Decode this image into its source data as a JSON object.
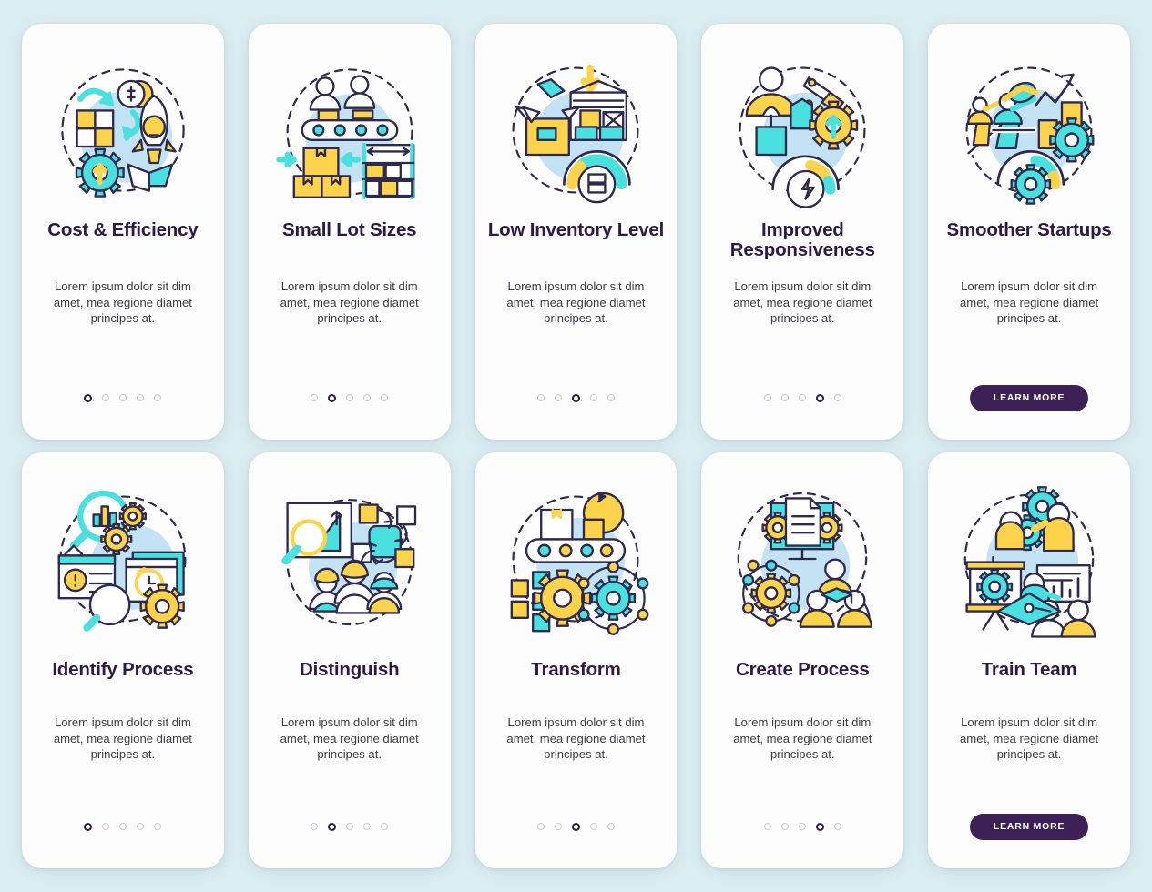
{
  "theme": {
    "background": "#dcedf1",
    "card_bg": "#fdfdfd",
    "title_color": "#2e1a47",
    "body_color": "#3a3a46",
    "accent_cyan": "#4ae0e0",
    "accent_yellow": "#fcd34a",
    "accent_lightblue": "#c3e3f5",
    "outline": "#2e2a4f",
    "button_bg": "#3d2156",
    "dot_inactive": "#c9c9d2"
  },
  "shared": {
    "description": "Lorem ipsum dolor sit dim amet, mea regione diamet principes at.",
    "learn_more_label": "LEARN MORE"
  },
  "rows": [
    {
      "id": "row-1",
      "cards": [
        {
          "id": "cost-efficiency",
          "title": "Cost & Efficiency",
          "illustration": "cost-efficiency-illustration",
          "footer": "dots",
          "dots_total": 5,
          "dots_active": 1
        },
        {
          "id": "small-lot-sizes",
          "title": "Small Lot Sizes",
          "illustration": "small-lot-sizes-illustration",
          "footer": "dots",
          "dots_total": 5,
          "dots_active": 2
        },
        {
          "id": "low-inventory-level",
          "title": "Low Inventory Level",
          "illustration": "low-inventory-illustration",
          "footer": "dots",
          "dots_total": 5,
          "dots_active": 3
        },
        {
          "id": "improved-responsiveness",
          "title": "Improved Responsiveness",
          "illustration": "improved-responsiveness-illustration",
          "footer": "dots",
          "dots_total": 5,
          "dots_active": 4
        },
        {
          "id": "smoother-startups",
          "title": "Smoother Startups",
          "illustration": "smoother-startups-illustration",
          "footer": "button"
        }
      ]
    },
    {
      "id": "row-2",
      "cards": [
        {
          "id": "identify-process",
          "title": "Identify Process",
          "illustration": "identify-process-illustration",
          "footer": "dots",
          "dots_total": 5,
          "dots_active": 1
        },
        {
          "id": "distinguish",
          "title": "Distinguish",
          "illustration": "distinguish-illustration",
          "footer": "dots",
          "dots_total": 5,
          "dots_active": 2
        },
        {
          "id": "transform",
          "title": "Transform",
          "illustration": "transform-illustration",
          "footer": "dots",
          "dots_total": 5,
          "dots_active": 3
        },
        {
          "id": "create-process",
          "title": "Create Process",
          "illustration": "create-process-illustration",
          "footer": "dots",
          "dots_total": 5,
          "dots_active": 4
        },
        {
          "id": "train-team",
          "title": "Train Team",
          "illustration": "train-team-illustration",
          "footer": "button"
        }
      ]
    }
  ]
}
